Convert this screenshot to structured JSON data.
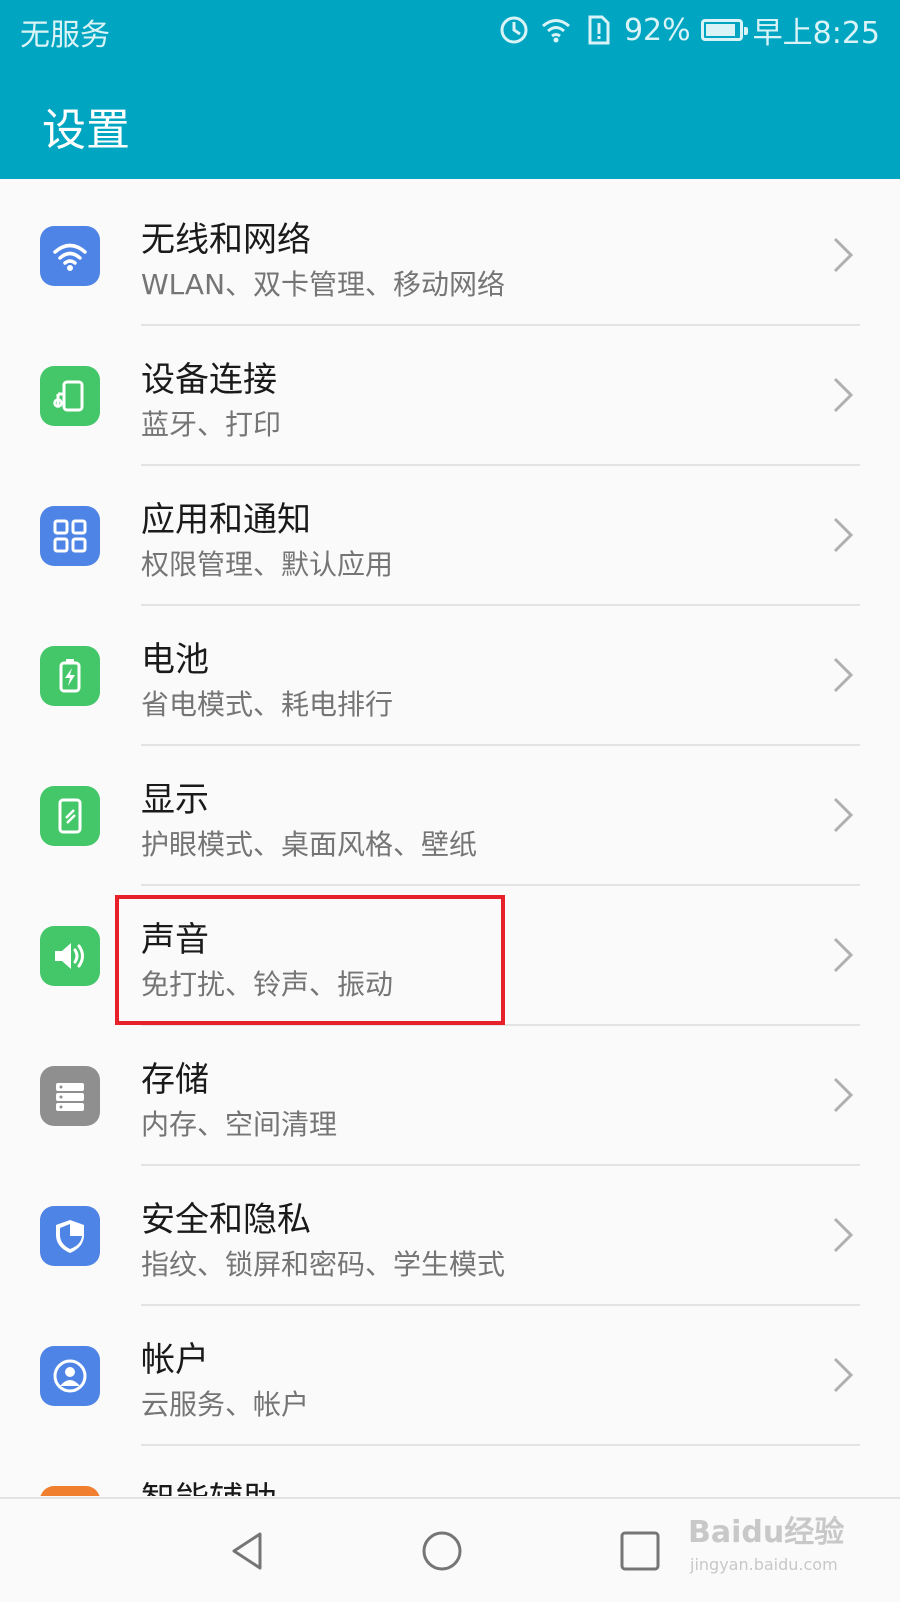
{
  "status_bar": {
    "carrier": "无服务",
    "battery_percent_text": "92%",
    "battery_level": 0.92,
    "time": "早上8:25",
    "icons": [
      "data-saver-icon",
      "wifi-icon",
      "sim-alert-icon",
      "battery-icon"
    ]
  },
  "header": {
    "title": "设置"
  },
  "settings_items": [
    {
      "title": "无线和网络",
      "subtitle": "WLAN、双卡管理、移动网络",
      "icon": "wifi-icon",
      "color": "#4d84e6"
    },
    {
      "title": "设备连接",
      "subtitle": "蓝牙、打印",
      "icon": "device-connection-icon",
      "color": "#43c768"
    },
    {
      "title": "应用和通知",
      "subtitle": "权限管理、默认应用",
      "icon": "apps-grid-icon",
      "color": "#4d84e6"
    },
    {
      "title": "电池",
      "subtitle": "省电模式、耗电排行",
      "icon": "battery-charging-icon",
      "color": "#43c768"
    },
    {
      "title": "显示",
      "subtitle": "护眼模式、桌面风格、壁纸",
      "icon": "display-icon",
      "color": "#43c768"
    },
    {
      "title": "声音",
      "subtitle": "免打扰、铃声、振动",
      "icon": "speaker-icon",
      "color": "#43c768"
    },
    {
      "title": "存储",
      "subtitle": "内存、空间清理",
      "icon": "storage-icon",
      "color": "#8f8f8f"
    },
    {
      "title": "安全和隐私",
      "subtitle": "指纹、锁屏和密码、学生模式",
      "icon": "shield-icon",
      "color": "#4d84e6"
    },
    {
      "title": "帐户",
      "subtitle": "云服务、帐户",
      "icon": "account-icon",
      "color": "#4d84e6"
    }
  ],
  "partial_item": {
    "title": "智能辅助",
    "icon": "assist-icon",
    "color": "#f08030"
  },
  "highlight_color": "#e8202a",
  "nav_bar": {
    "buttons": [
      "back-icon",
      "home-icon",
      "recents-icon"
    ]
  },
  "watermark": {
    "brand": "Baidu经验",
    "url": "jingyan.baidu.com"
  }
}
